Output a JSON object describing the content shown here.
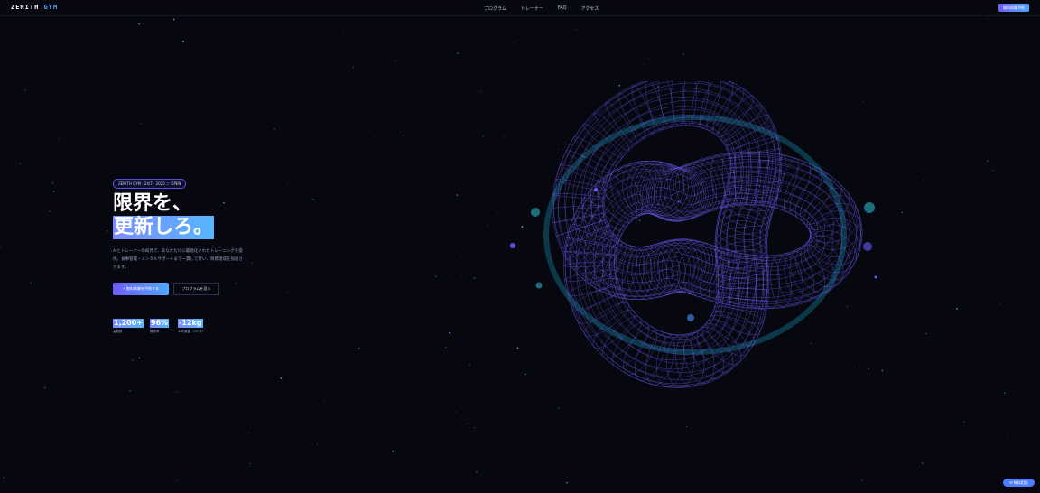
{
  "nav": {
    "logo_text": "ZENITH",
    "logo_accent": "GYM",
    "menu": [
      {
        "label": "プログラム"
      },
      {
        "label": "トレーナー"
      },
      {
        "label": "FAQ"
      },
      {
        "label": "アクセス"
      }
    ],
    "cta_label": "無料体験予約"
  },
  "hero": {
    "badge": "ZENITH GYM · 24/7 · 2025 ＝ OPEN",
    "headline_line1": "限界を、",
    "headline_line2": "更新しろ。",
    "lead": "AIとトレーナーの知見で、あなただけに最適化されたトレーニングを提供。食事管理・メンタルサポートまで一貫して行い、目標達成を加速させます。",
    "primary_cta": "⚡ 無料体験を予約する",
    "secondary_cta": "プログラムを見る"
  },
  "stats": [
    {
      "value": "1,200+",
      "label": "会員数"
    },
    {
      "value": "96%",
      "label": "継続率"
    },
    {
      "value": "-12kg",
      "label": "平均減量（3ヶ月）"
    }
  ],
  "floating": {
    "chat_label": "✉ 無料相談"
  },
  "colors": {
    "background": "#06070f",
    "knot": "#6a5cf0",
    "ring": "#0f4f63",
    "accent_gradient_start": "#6d5cff",
    "accent_gradient_end": "#4ea8ff"
  }
}
